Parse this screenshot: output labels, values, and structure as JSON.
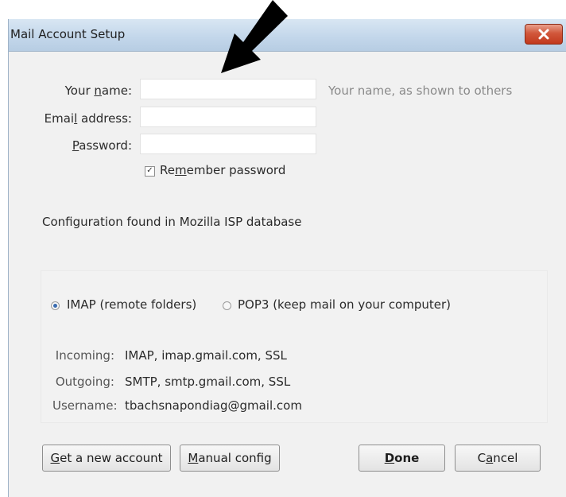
{
  "window": {
    "title": "Mail Account Setup",
    "close_label": "×"
  },
  "form": {
    "name_label_pre": "Your ",
    "name_label_u": "n",
    "name_label_post": "ame:",
    "name_value": "",
    "name_hint": "Your name, as shown to others",
    "email_label_pre": "Emai",
    "email_label_u": "l",
    "email_label_post": " address:",
    "email_value": "",
    "password_label_u": "P",
    "password_label_post": "assword:",
    "password_value": "",
    "remember_pre": "Re",
    "remember_u": "m",
    "remember_post": "ember password",
    "remember_checked": true,
    "status": "Configuration found in Mozilla ISP database"
  },
  "protocol": {
    "imap_label": "IMAP (remote folders)",
    "pop3_label": "POP3 (keep mail on your computer)",
    "selected": "IMAP"
  },
  "servers": {
    "incoming_label": "Incoming:",
    "incoming_value": "IMAP, imap.gmail.com, SSL",
    "outgoing_label": "Outgoing:",
    "outgoing_value": "SMTP, smtp.gmail.com, SSL",
    "username_label": "Username:",
    "username_value": "tbachsnapondiag@gmail.com"
  },
  "buttons": {
    "new_account_u": "G",
    "new_account_post": "et a new account",
    "manual_u": "M",
    "manual_post": "anual config",
    "done_u": "D",
    "done_post": "one",
    "cancel_pre": "C",
    "cancel_u": "a",
    "cancel_post": "ncel"
  },
  "colors": {
    "title_bar": "#c2d6ea",
    "close_button": "#c2391d",
    "radio_selected": "#3b6cb0"
  }
}
